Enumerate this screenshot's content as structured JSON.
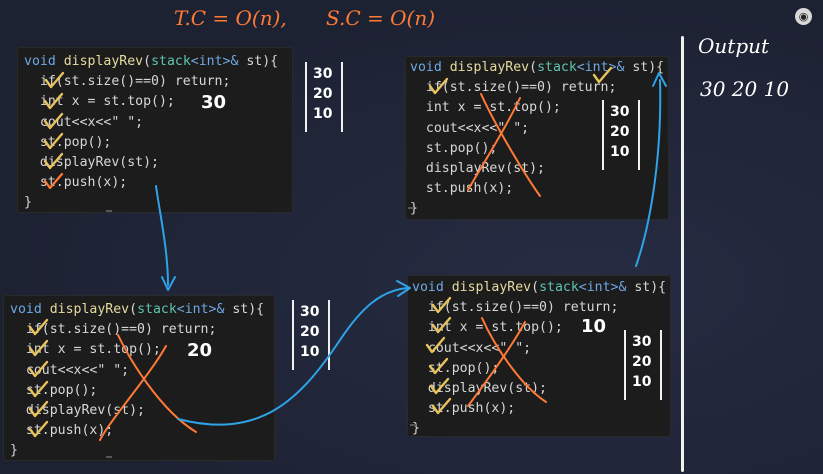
{
  "complexity": {
    "time": "T.C = O(n),",
    "space": "S.C = O(n)"
  },
  "output": {
    "title": "Output",
    "values": "30 20 10"
  },
  "code_lines": [
    [
      "void",
      " ",
      "displayRev",
      "(",
      "stack",
      "<int>&",
      " st){"
    ],
    [
      "  if(st.size()==0) return;"
    ],
    [
      "  int x = st.top();"
    ],
    [
      "  cout<<x<<\" \";"
    ],
    [
      "  st.pop();"
    ],
    [
      "  displayRev(st);"
    ],
    [
      "  st.push(x);"
    ],
    [
      "}"
    ]
  ],
  "frames": [
    {
      "id": "frame-1",
      "top_value": "30",
      "stack": [
        "30",
        "20",
        "10"
      ]
    },
    {
      "id": "frame-2",
      "top_value": "20",
      "stack": [
        "30",
        "20",
        "10"
      ]
    },
    {
      "id": "frame-3",
      "top_value": "10",
      "stack": [
        "30",
        "20",
        "10"
      ]
    },
    {
      "id": "frame-4",
      "top_value": "",
      "stack": [
        "30",
        "20",
        "10"
      ]
    }
  ],
  "colors": {
    "annotation_orange": "#ff7a35",
    "arrow_blue": "#2fa3e8",
    "annotation_white": "#ffffff",
    "code_background": "#1c1c1c"
  },
  "icons": {
    "logo": "circle-logo-icon"
  }
}
